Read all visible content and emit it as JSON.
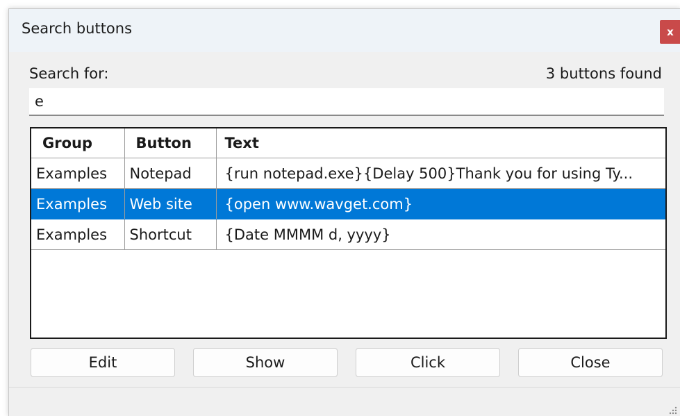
{
  "dialog": {
    "title": "Search buttons",
    "close_label": "x"
  },
  "search": {
    "label": "Search for:",
    "value": "e",
    "result_count": "3 buttons found"
  },
  "table": {
    "columns": [
      "Group",
      "Button",
      "Text"
    ],
    "rows": [
      {
        "group": "Examples",
        "button": "Notepad",
        "text": "{run notepad.exe}{Delay 500}Thank you for using Ty..."
      },
      {
        "group": "Examples",
        "button": "Web site",
        "text": "{open www.wavget.com}"
      },
      {
        "group": "Examples",
        "button": "Shortcut",
        "text": "{Date MMMM d, yyyy}"
      }
    ],
    "selected_row": 1
  },
  "buttons": {
    "edit": "Edit",
    "show": "Show",
    "click": "Click",
    "close": "Close"
  },
  "colors": {
    "selection": "#0078d7",
    "close_button": "#c94a4a",
    "titlebar": "#eef3f8"
  },
  "icons": {
    "resize_grip": "resize-grip-icon"
  }
}
